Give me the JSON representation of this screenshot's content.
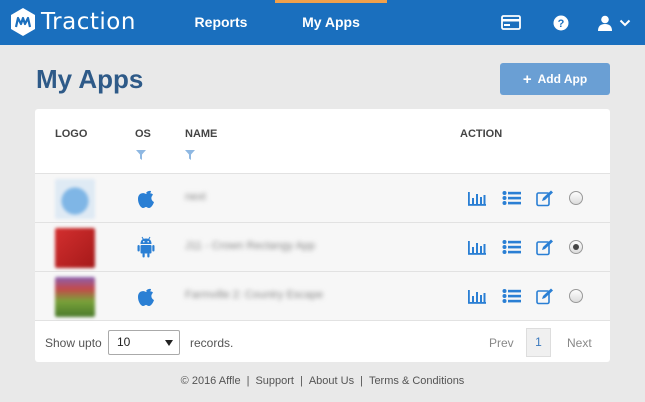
{
  "brand": {
    "name": "Traction"
  },
  "nav": {
    "reports": "Reports",
    "my_apps": "My Apps",
    "icons": [
      "card-icon",
      "help-icon",
      "user-icon",
      "chevron-down-icon"
    ]
  },
  "header": {
    "title": "My Apps",
    "add_button": "Add App"
  },
  "table": {
    "columns": {
      "logo": "LOGO",
      "os": "OS",
      "name": "NAME",
      "action": "ACTION"
    },
    "rows": [
      {
        "os": "ios",
        "name": "next",
        "logo_color": "#7fb6e6",
        "selected": false
      },
      {
        "os": "android",
        "name": "J11 - Crown Rectangy App",
        "logo_color": "#c62828",
        "selected": true
      },
      {
        "os": "ios",
        "name": "Farmville 2: Country Escape",
        "logo_color": "#6a8d3a",
        "selected": false
      }
    ]
  },
  "pagination": {
    "show_label": "Show upto",
    "page_size": "10",
    "records_label": "records.",
    "prev": "Prev",
    "current_page": "1",
    "next": "Next"
  },
  "footer": {
    "copyright": "© 2016 Affle",
    "links": [
      "Support",
      "About Us",
      "Terms & Conditions"
    ]
  },
  "colors": {
    "nav_bg": "#1a6fbe",
    "accent": "#f0a04b",
    "title": "#2e5a88",
    "icon_blue": "#2a7fd4"
  }
}
